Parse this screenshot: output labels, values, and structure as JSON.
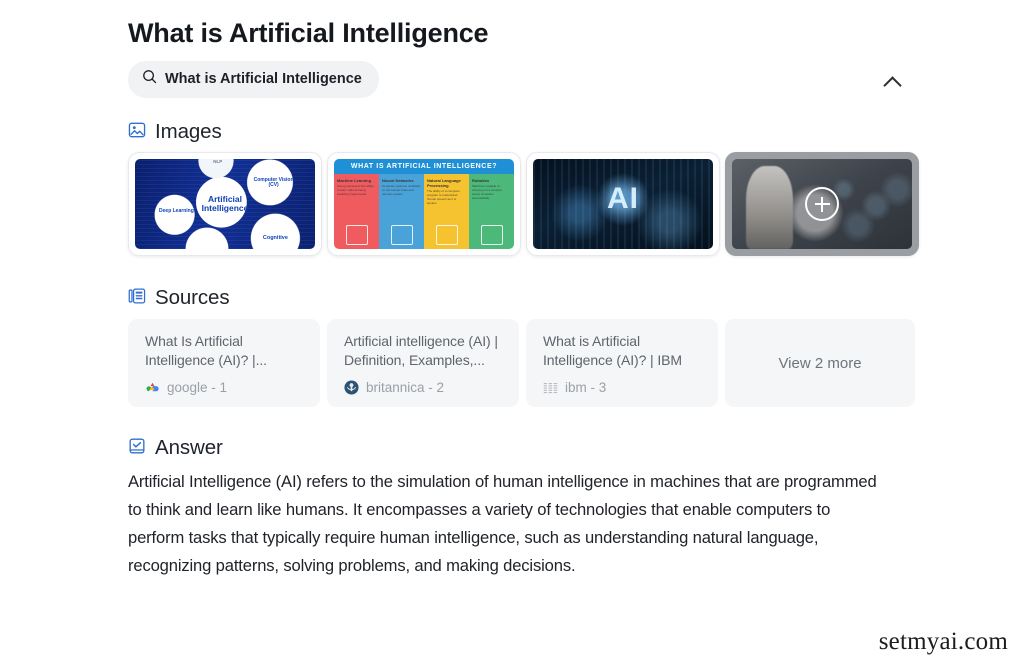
{
  "header": {
    "title": "What is Artificial Intelligence",
    "collapse_icon": "chevron-up-icon"
  },
  "query_chip": {
    "icon": "search-icon",
    "text": "What is Artificial Intelligence"
  },
  "images_section": {
    "icon": "image-icon",
    "title": "Images",
    "items": [
      {
        "alt": "Artificial Intelligence mind map diagram with Deep Learning, Computer Vision (CV), Cognitive and NLP nodes on dark blue background",
        "labels": {
          "center": "Artificial Intelligence",
          "deep_learning": "Deep Learning",
          "computer_vision": "Computer Vision (CV)",
          "cognitive": "Cognitive",
          "nlp": "NLP"
        }
      },
      {
        "alt": "What is Artificial Intelligence infographic with four colored columns",
        "heading": "WHAT IS ARTIFICIAL INTELLIGENCE?",
        "columns": [
          {
            "title": "Machine Learning",
            "body": "Giving computers the ability to learn without being explicitly programmed"
          },
          {
            "title": "Neural Networks",
            "body": "Computer systems modelled on the human brain and nervous system"
          },
          {
            "title": "Natural Language Processing",
            "body": "The ability of a computer program to understand human speech as it is spoken"
          },
          {
            "title": "Robotics",
            "body": "Machines capable of carrying out a complex series of actions automatically"
          }
        ]
      },
      {
        "alt": "Glowing AI letters over a dark blue digital city with a robotic hand",
        "overlay_text": "AI"
      },
      {
        "alt": "Humanoid robot beside a glowing network of connected icons",
        "overlay_icon": "plus-icon",
        "selected": true
      }
    ]
  },
  "sources_section": {
    "icon": "sources-icon",
    "title": "Sources",
    "items": [
      {
        "title": "What Is Artificial Intelligence (AI)? |...",
        "favicon": "google-cloud-icon",
        "domain": "google",
        "index": "1",
        "meta": "google - 1"
      },
      {
        "title": "Artificial intelligence (AI) | Definition, Examples,...",
        "favicon": "britannica-icon",
        "domain": "britannica",
        "index": "2",
        "meta": "britannica - 2"
      },
      {
        "title": "What is Artificial Intelligence (AI)? | IBM",
        "favicon": "ibm-icon",
        "domain": "ibm",
        "index": "3",
        "meta": "ibm - 3"
      }
    ],
    "view_more_label": "View 2 more"
  },
  "answer_section": {
    "icon": "answer-check-icon",
    "title": "Answer",
    "body": "Artificial Intelligence (AI) refers to the simulation of human intelligence in machines that are programmed to think and learn like humans. It encompasses a variety of technologies that enable computers to perform tasks that typically require human intelligence, such as understanding natural language, recognizing patterns, solving problems, and making decisions."
  },
  "watermark": "setmyai.com",
  "colors": {
    "accent": "#2f6fd0",
    "chip_bg": "#f1f2f4",
    "card_bg": "#f5f6f7",
    "text": "#20242a",
    "muted": "#9aa0a7"
  }
}
